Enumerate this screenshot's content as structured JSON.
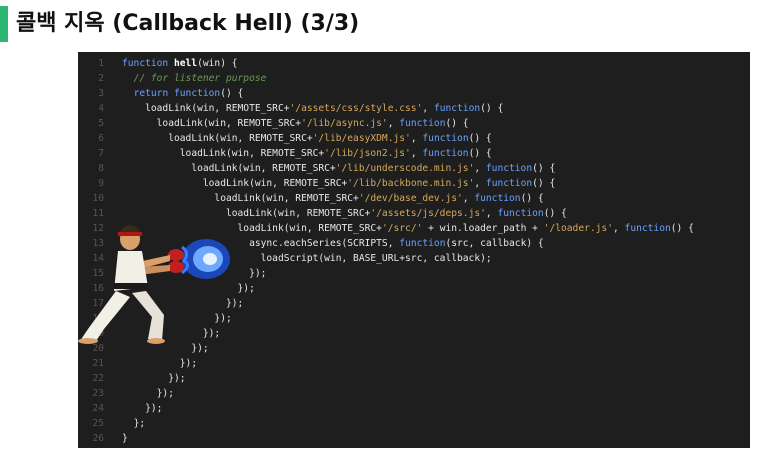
{
  "page": {
    "title": "콜백 지옥 (Callback Hell) (3/3)"
  },
  "colors": {
    "accent": "#2bb673",
    "code_bg": "#1e1e1e",
    "keyword": "#6aa0ff",
    "string": "#d6a85a",
    "comment": "#6a9955"
  },
  "code": {
    "lines": [
      {
        "n": "1",
        "indent": 0,
        "parts": [
          {
            "t": "k",
            "v": "function "
          },
          {
            "t": "fn",
            "v": "hell"
          },
          {
            "t": "txt",
            "v": "(win) {"
          }
        ]
      },
      {
        "n": "2",
        "indent": 1,
        "parts": [
          {
            "t": "c",
            "v": "// for listener purpose"
          }
        ]
      },
      {
        "n": "3",
        "indent": 1,
        "parts": [
          {
            "t": "k",
            "v": "return "
          },
          {
            "t": "k",
            "v": "function"
          },
          {
            "t": "txt",
            "v": "() {"
          }
        ]
      },
      {
        "n": "4",
        "indent": 2,
        "parts": [
          {
            "t": "txt",
            "v": "loadLink(win, REMOTE_SRC+"
          },
          {
            "t": "s",
            "v": "'/assets/css/style.css'"
          },
          {
            "t": "txt",
            "v": ", "
          },
          {
            "t": "k",
            "v": "function"
          },
          {
            "t": "txt",
            "v": "() {"
          }
        ]
      },
      {
        "n": "5",
        "indent": 3,
        "parts": [
          {
            "t": "txt",
            "v": "loadLink(win, REMOTE_SRC+"
          },
          {
            "t": "s",
            "v": "'/lib/async.js'"
          },
          {
            "t": "txt",
            "v": ", "
          },
          {
            "t": "k",
            "v": "function"
          },
          {
            "t": "txt",
            "v": "() {"
          }
        ]
      },
      {
        "n": "6",
        "indent": 4,
        "parts": [
          {
            "t": "txt",
            "v": "loadLink(win, REMOTE_SRC+"
          },
          {
            "t": "s",
            "v": "'/lib/easyXDM.js'"
          },
          {
            "t": "txt",
            "v": ", "
          },
          {
            "t": "k",
            "v": "function"
          },
          {
            "t": "txt",
            "v": "() {"
          }
        ]
      },
      {
        "n": "7",
        "indent": 5,
        "parts": [
          {
            "t": "txt",
            "v": "loadLink(win, REMOTE_SRC+"
          },
          {
            "t": "s",
            "v": "'/lib/json2.js'"
          },
          {
            "t": "txt",
            "v": ", "
          },
          {
            "t": "k",
            "v": "function"
          },
          {
            "t": "txt",
            "v": "() {"
          }
        ]
      },
      {
        "n": "8",
        "indent": 6,
        "parts": [
          {
            "t": "txt",
            "v": "loadLink(win, REMOTE_SRC+"
          },
          {
            "t": "s",
            "v": "'/lib/underscode.min.js'"
          },
          {
            "t": "txt",
            "v": ", "
          },
          {
            "t": "k",
            "v": "function"
          },
          {
            "t": "txt",
            "v": "() {"
          }
        ]
      },
      {
        "n": "9",
        "indent": 7,
        "parts": [
          {
            "t": "txt",
            "v": "loadLink(win, REMOTE_SRC+"
          },
          {
            "t": "s",
            "v": "'/lib/backbone.min.js'"
          },
          {
            "t": "txt",
            "v": ", "
          },
          {
            "t": "k",
            "v": "function"
          },
          {
            "t": "txt",
            "v": "() {"
          }
        ]
      },
      {
        "n": "10",
        "indent": 8,
        "parts": [
          {
            "t": "txt",
            "v": "loadLink(win, REMOTE_SRC+"
          },
          {
            "t": "s",
            "v": "'/dev/base_dev.js'"
          },
          {
            "t": "txt",
            "v": ", "
          },
          {
            "t": "k",
            "v": "function"
          },
          {
            "t": "txt",
            "v": "() {"
          }
        ]
      },
      {
        "n": "11",
        "indent": 9,
        "parts": [
          {
            "t": "txt",
            "v": "loadLink(win, REMOTE_SRC+"
          },
          {
            "t": "s",
            "v": "'/assets/js/deps.js'"
          },
          {
            "t": "txt",
            "v": ", "
          },
          {
            "t": "k",
            "v": "function"
          },
          {
            "t": "txt",
            "v": "() {"
          }
        ]
      },
      {
        "n": "12",
        "indent": 10,
        "parts": [
          {
            "t": "txt",
            "v": "loadLink(win, REMOTE_SRC+"
          },
          {
            "t": "s",
            "v": "'/src/'"
          },
          {
            "t": "txt",
            "v": " + win.loader_path + "
          },
          {
            "t": "s",
            "v": "'/loader.js'"
          },
          {
            "t": "txt",
            "v": ", "
          },
          {
            "t": "k",
            "v": "function"
          },
          {
            "t": "txt",
            "v": "() {"
          }
        ]
      },
      {
        "n": "13",
        "indent": 11,
        "parts": [
          {
            "t": "txt",
            "v": "async.eachSeries(SCRIPTS, "
          },
          {
            "t": "k",
            "v": "function"
          },
          {
            "t": "txt",
            "v": "(src, callback) {"
          }
        ]
      },
      {
        "n": "14",
        "indent": 12,
        "parts": [
          {
            "t": "txt",
            "v": "loadScript(win, BASE_URL+src, callback);"
          }
        ]
      },
      {
        "n": "15",
        "indent": 11,
        "parts": [
          {
            "t": "txt",
            "v": "});"
          }
        ]
      },
      {
        "n": "16",
        "indent": 10,
        "parts": [
          {
            "t": "txt",
            "v": "});"
          }
        ]
      },
      {
        "n": "17",
        "indent": 9,
        "parts": [
          {
            "t": "txt",
            "v": "});"
          }
        ]
      },
      {
        "n": "18",
        "indent": 8,
        "parts": [
          {
            "t": "txt",
            "v": "});"
          }
        ]
      },
      {
        "n": "19",
        "indent": 7,
        "parts": [
          {
            "t": "txt",
            "v": "});"
          }
        ]
      },
      {
        "n": "20",
        "indent": 6,
        "parts": [
          {
            "t": "txt",
            "v": "});"
          }
        ]
      },
      {
        "n": "21",
        "indent": 5,
        "parts": [
          {
            "t": "txt",
            "v": "});"
          }
        ]
      },
      {
        "n": "22",
        "indent": 4,
        "parts": [
          {
            "t": "txt",
            "v": "});"
          }
        ]
      },
      {
        "n": "23",
        "indent": 3,
        "parts": [
          {
            "t": "txt",
            "v": "});"
          }
        ]
      },
      {
        "n": "24",
        "indent": 2,
        "parts": [
          {
            "t": "txt",
            "v": "});"
          }
        ]
      },
      {
        "n": "25",
        "indent": 1,
        "parts": [
          {
            "t": "txt",
            "v": "};"
          }
        ]
      },
      {
        "n": "26",
        "indent": 0,
        "parts": [
          {
            "t": "txt",
            "v": "}"
          }
        ]
      }
    ]
  },
  "image": {
    "icon": "fighter-hadouken-icon"
  }
}
